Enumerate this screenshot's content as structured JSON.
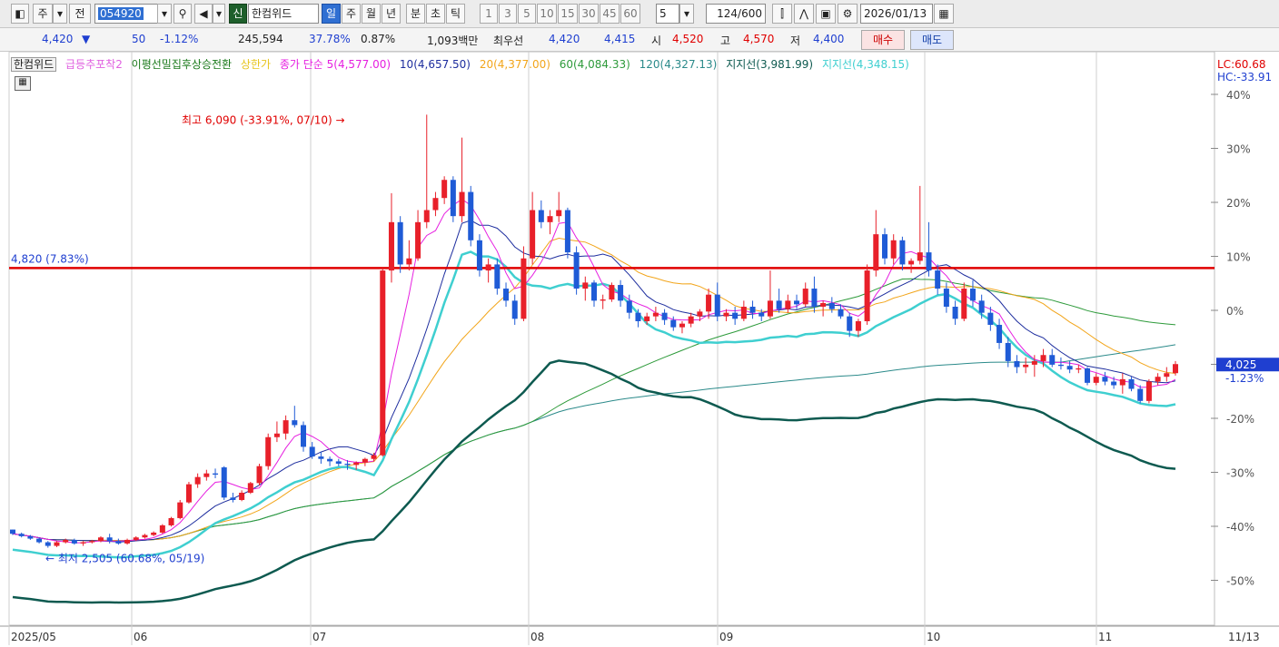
{
  "toolbar": {
    "market_btn": "주",
    "prev_btn": "전",
    "code": "054920",
    "credit_badge": "신",
    "stock_name": "한컴위드",
    "periods": [
      "일",
      "주",
      "월",
      "년",
      "분",
      "초",
      "틱"
    ],
    "selected_period": "일",
    "intervals": [
      "1",
      "3",
      "5",
      "10",
      "15",
      "30",
      "45",
      "60"
    ],
    "custom_interval": "5",
    "count": "124",
    "count_total": "/600",
    "date": "2026/01/13"
  },
  "info": {
    "price": "4,420",
    "change_arrow": "▼",
    "change": "50",
    "change_pct": "-1.12%",
    "volume": "245,594",
    "vol_ratio": "37.78%",
    "turnover": "0.87%",
    "amount": "1,093백만",
    "best_label": "최우선",
    "ask": "4,420",
    "bid": "4,415",
    "open_label": "시",
    "open": "4,520",
    "high_label": "고",
    "high": "4,570",
    "low_label": "저",
    "low": "4,400",
    "buy_btn": "매수",
    "sell_btn": "매도"
  },
  "legend": {
    "name": "한컴위드",
    "ind1": "급등추포착2",
    "ind2": "이평선밀집후상승전환",
    "ind3": "상한가",
    "ma_title": "종가 단순 5(4,577.00)",
    "ma10": "10(4,657.50)",
    "ma20": "20(4,377.00)",
    "ma60": "60(4,084.33)",
    "ma120": "120(4,327.13)",
    "support1": "지지선(3,981.99)",
    "support2": "지지선(4,348.15)"
  },
  "colors": {
    "up": "#e8202a",
    "down": "#1f5bd6",
    "ma5": "#e61fe0",
    "ma10": "#1d2d9e",
    "ma20": "#f2a51a",
    "ma60": "#2d9a3a",
    "ma120": "#2b8a8a",
    "support_dark": "#0e5a50",
    "support_light": "#3fcfd0",
    "hline": "#e00000"
  },
  "chart_data": {
    "type": "candlestick",
    "dates_axis": [
      "2025/05",
      "06",
      "07",
      "08",
      "09",
      "10",
      "11"
    ],
    "right_date": "11/13",
    "y_ticks": [
      "40%",
      "30%",
      "20%",
      "10%",
      "0%",
      "-10%",
      "-20%",
      "-30%",
      "-40%",
      "-50%"
    ],
    "lc": "LC:60.68",
    "hc": "HC:-33.91",
    "last_price": "4,025",
    "last_pct": "-1.23%",
    "hline_label": "4,820 (7.83%)",
    "high_annotation": "최고 6,090 (-33.91%, 07/10) →",
    "low_annotation": "← 최저 2,505 (60.68%, 05/19)",
    "candles": [
      [
        2655,
        2655,
        2610,
        2620
      ],
      [
        2620,
        2630,
        2590,
        2600
      ],
      [
        2600,
        2610,
        2570,
        2580
      ],
      [
        2580,
        2590,
        2540,
        2550
      ],
      [
        2550,
        2560,
        2505,
        2520
      ],
      [
        2520,
        2560,
        2510,
        2550
      ],
      [
        2550,
        2580,
        2540,
        2570
      ],
      [
        2570,
        2580,
        2530,
        2540
      ],
      [
        2540,
        2560,
        2520,
        2550
      ],
      [
        2550,
        2570,
        2540,
        2560
      ],
      [
        2560,
        2600,
        2550,
        2590
      ],
      [
        2590,
        2620,
        2540,
        2560
      ],
      [
        2560,
        2580,
        2530,
        2540
      ],
      [
        2540,
        2580,
        2530,
        2570
      ],
      [
        2570,
        2600,
        2560,
        2590
      ],
      [
        2590,
        2620,
        2580,
        2610
      ],
      [
        2610,
        2640,
        2600,
        2630
      ],
      [
        2630,
        2700,
        2620,
        2690
      ],
      [
        2690,
        2760,
        2680,
        2750
      ],
      [
        2750,
        2900,
        2740,
        2880
      ],
      [
        2880,
        3050,
        2870,
        3030
      ],
      [
        3030,
        3120,
        3000,
        3090
      ],
      [
        3090,
        3150,
        3060,
        3120
      ],
      [
        3120,
        3160,
        3080,
        3110
      ],
      [
        3170,
        3180,
        2900,
        2920
      ],
      [
        2920,
        2960,
        2880,
        2900
      ],
      [
        2900,
        2980,
        2890,
        2960
      ],
      [
        2960,
        3050,
        2950,
        3040
      ],
      [
        3040,
        3200,
        3020,
        3180
      ],
      [
        3180,
        3450,
        3150,
        3420
      ],
      [
        3420,
        3550,
        3380,
        3450
      ],
      [
        3450,
        3600,
        3400,
        3560
      ],
      [
        3560,
        3680,
        3500,
        3520
      ],
      [
        3520,
        3550,
        3300,
        3340
      ],
      [
        3340,
        3380,
        3240,
        3260
      ],
      [
        3260,
        3300,
        3200,
        3240
      ],
      [
        3240,
        3260,
        3180,
        3220
      ],
      [
        3220,
        3240,
        3180,
        3200
      ],
      [
        3200,
        3230,
        3150,
        3190
      ],
      [
        3190,
        3220,
        3150,
        3210
      ],
      [
        3210,
        3250,
        3180,
        3240
      ],
      [
        3240,
        3290,
        3220,
        3270
      ],
      [
        3270,
        4820,
        3260,
        4800
      ],
      [
        4800,
        5440,
        4700,
        5200
      ],
      [
        5200,
        5250,
        4780,
        4850
      ],
      [
        4850,
        5050,
        4800,
        4900
      ],
      [
        4900,
        5300,
        4880,
        5200
      ],
      [
        5200,
        6090,
        5150,
        5300
      ],
      [
        5300,
        5450,
        5250,
        5400
      ],
      [
        5400,
        5580,
        5350,
        5550
      ],
      [
        5550,
        5580,
        5200,
        5250
      ],
      [
        5250,
        5900,
        5200,
        5450
      ],
      [
        5450,
        5500,
        5000,
        5050
      ],
      [
        5050,
        5100,
        4750,
        4800
      ],
      [
        4800,
        4900,
        4700,
        4850
      ],
      [
        4850,
        4900,
        4600,
        4650
      ],
      [
        4650,
        4700,
        4500,
        4550
      ],
      [
        4550,
        4600,
        4350,
        4400
      ],
      [
        4400,
        5000,
        4380,
        4900
      ],
      [
        4900,
        5450,
        4850,
        5300
      ],
      [
        5300,
        5380,
        5150,
        5200
      ],
      [
        5200,
        5300,
        5100,
        5250
      ],
      [
        5250,
        5450,
        5200,
        5300
      ],
      [
        5300,
        5320,
        4900,
        4950
      ],
      [
        4950,
        5000,
        4600,
        4650
      ],
      [
        4650,
        4750,
        4550,
        4700
      ],
      [
        4700,
        4720,
        4500,
        4550
      ],
      [
        4550,
        4600,
        4480,
        4560
      ],
      [
        4560,
        4700,
        4540,
        4680
      ],
      [
        4680,
        4720,
        4500,
        4550
      ],
      [
        4550,
        4600,
        4400,
        4450
      ],
      [
        4450,
        4480,
        4330,
        4380
      ],
      [
        4380,
        4450,
        4350,
        4420
      ],
      [
        4420,
        4500,
        4380,
        4450
      ],
      [
        4450,
        4480,
        4350,
        4390
      ],
      [
        4390,
        4420,
        4300,
        4330
      ],
      [
        4330,
        4380,
        4280,
        4360
      ],
      [
        4360,
        4450,
        4330,
        4420
      ],
      [
        4420,
        4480,
        4380,
        4460
      ],
      [
        4460,
        4650,
        4400,
        4600
      ],
      [
        4600,
        4700,
        4380,
        4420
      ],
      [
        4420,
        4480,
        4380,
        4450
      ],
      [
        4450,
        4500,
        4350,
        4400
      ],
      [
        4400,
        4550,
        4380,
        4500
      ],
      [
        4500,
        4550,
        4400,
        4450
      ],
      [
        4450,
        4480,
        4380,
        4420
      ],
      [
        4420,
        4800,
        4400,
        4550
      ],
      [
        4550,
        4650,
        4450,
        4480
      ],
      [
        4480,
        4600,
        4450,
        4550
      ],
      [
        4550,
        4600,
        4480,
        4520
      ],
      [
        4520,
        4700,
        4500,
        4650
      ],
      [
        4650,
        4750,
        4450,
        4500
      ],
      [
        4500,
        4550,
        4420,
        4530
      ],
      [
        4530,
        4580,
        4450,
        4480
      ],
      [
        4480,
        4520,
        4400,
        4420
      ],
      [
        4420,
        4450,
        4250,
        4300
      ],
      [
        4300,
        4400,
        4250,
        4380
      ],
      [
        4380,
        4850,
        4350,
        4800
      ],
      [
        4800,
        5300,
        4750,
        5100
      ],
      [
        5100,
        5150,
        4850,
        4900
      ],
      [
        4900,
        5100,
        4850,
        5050
      ],
      [
        5050,
        5080,
        4800,
        4850
      ],
      [
        4850,
        4900,
        4780,
        4880
      ],
      [
        4880,
        5500,
        4850,
        4950
      ],
      [
        4950,
        5200,
        4750,
        4800
      ],
      [
        4800,
        4850,
        4600,
        4650
      ],
      [
        4650,
        4700,
        4450,
        4500
      ],
      [
        4500,
        4550,
        4350,
        4400
      ],
      [
        4400,
        4700,
        4380,
        4650
      ],
      [
        4650,
        4720,
        4500,
        4550
      ],
      [
        4550,
        4600,
        4400,
        4450
      ],
      [
        4450,
        4500,
        4300,
        4350
      ],
      [
        4350,
        4400,
        4150,
        4200
      ],
      [
        4200,
        4250,
        4000,
        4050
      ],
      [
        4050,
        4100,
        3950,
        4000
      ],
      [
        4000,
        4080,
        3950,
        4020
      ],
      [
        4020,
        4100,
        3920,
        4050
      ],
      [
        4050,
        4150,
        4000,
        4100
      ],
      [
        4100,
        4150,
        4000,
        4020
      ],
      [
        4020,
        4080,
        3980,
        4010
      ],
      [
        4010,
        4050,
        3950,
        3980
      ],
      [
        3980,
        4020,
        3950,
        3990
      ],
      [
        3990,
        4000,
        3850,
        3870
      ],
      [
        3870,
        3950,
        3850,
        3920
      ],
      [
        3920,
        3960,
        3850,
        3880
      ],
      [
        3880,
        3920,
        3820,
        3850
      ],
      [
        3850,
        3950,
        3780,
        3900
      ],
      [
        3900,
        3920,
        3800,
        3820
      ],
      [
        3820,
        3850,
        3700,
        3720
      ],
      [
        3720,
        3900,
        3700,
        3880
      ],
      [
        3880,
        3950,
        3850,
        3920
      ],
      [
        3920,
        4000,
        3880,
        3950
      ],
      [
        3950,
        4050,
        3930,
        4025
      ]
    ]
  }
}
